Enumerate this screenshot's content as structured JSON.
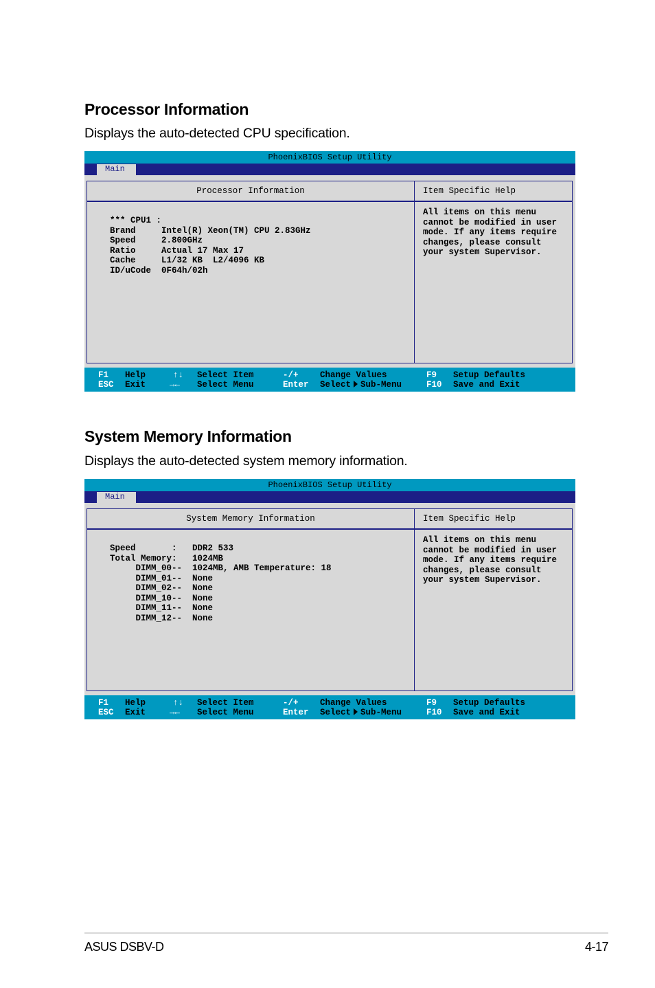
{
  "sections": [
    {
      "title": "Processor Information",
      "description": "Displays the auto-detected CPU specification.",
      "bios": {
        "title": "PhoenixBIOS Setup Utility",
        "tab": "Main",
        "panel_title": "Processor Information",
        "help_title": "Item Specific Help",
        "content": "*** CPU1 :\nBrand     Intel(R) Xeon(TM) CPU 2.83GHz\nSpeed     2.800GHz\nRatio     Actual 17 Max 17\nCache     L1/32 KB  L2/4096 KB\nID/uCode  0F64h/02h",
        "help_text": "All items on this menu\ncannot be modified in user\nmode. If any items require\nchanges, please consult\nyour system Supervisor."
      }
    },
    {
      "title": "System Memory Information",
      "description": "Displays the auto-detected system memory information.",
      "bios": {
        "title": "PhoenixBIOS Setup Utility",
        "tab": "Main",
        "panel_title": "System Memory Information",
        "help_title": "Item Specific Help",
        "content": "Speed       :   DDR2 533\nTotal Memory:   1024MB\n     DIMM_00--  1024MB, AMB Temperature: 18\n     DIMM_01--  None\n     DIMM_02--  None\n     DIMM_10--  None\n     DIMM_11--  None\n     DIMM_12--  None",
        "help_text": "All items on this menu\ncannot be modified in user\nmode. If any items require\nchanges, please consult\nyour system Supervisor."
      }
    }
  ],
  "bios_footer": {
    "f1_key": "F1",
    "f1_desc": "Help",
    "esc_key": "ESC",
    "esc_desc": "Exit",
    "updown_icon": "↑↓",
    "updown_desc": "Select Item",
    "leftright_icon": "→←",
    "leftright_desc": "Select Menu",
    "plusminus_key": "-/+",
    "plusminus_desc": "Change Values",
    "enter_key": "Enter",
    "enter_desc_pre": "Select",
    "enter_desc_post": "Sub-Menu",
    "f9_key": "F9",
    "f9_desc": "Setup Defaults",
    "f10_key": "F10",
    "f10_desc": "Save and Exit"
  },
  "page_footer": {
    "product": "ASUS DSBV-D",
    "page_number": "4-17"
  },
  "colors": {
    "bios_cyan": "#0099c0",
    "bios_navy": "#1c1f86",
    "bios_gray": "#d8d8d8"
  }
}
